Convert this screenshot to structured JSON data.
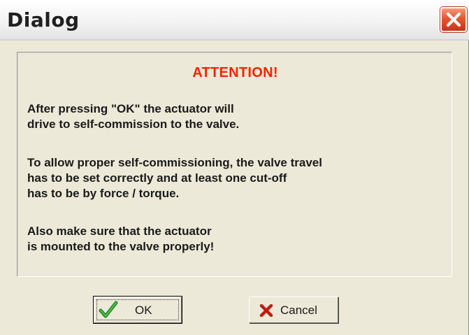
{
  "window": {
    "title": "Dialog"
  },
  "message": {
    "heading": "ATTENTION!",
    "paragraph1": [
      "After pressing \"OK\" the actuator will",
      "drive to self-commission to the valve."
    ],
    "paragraph2": [
      "To allow proper self-commissioning, the valve travel",
      "has to be set correctly and at least one cut-off",
      "has to be by force / torque."
    ],
    "paragraph3": [
      "Also make sure that the actuator",
      "is mounted to the valve properly!"
    ]
  },
  "buttons": {
    "ok_label": "OK",
    "cancel_label": "Cancel",
    "ok_icon": "checkmark-icon",
    "cancel_icon": "cross-icon",
    "close_icon": "close-icon"
  },
  "colors": {
    "attention": "#ff2000",
    "close_button": "#e2582f",
    "checkmark": "#2e9a2e",
    "cross": "#c81e12"
  }
}
